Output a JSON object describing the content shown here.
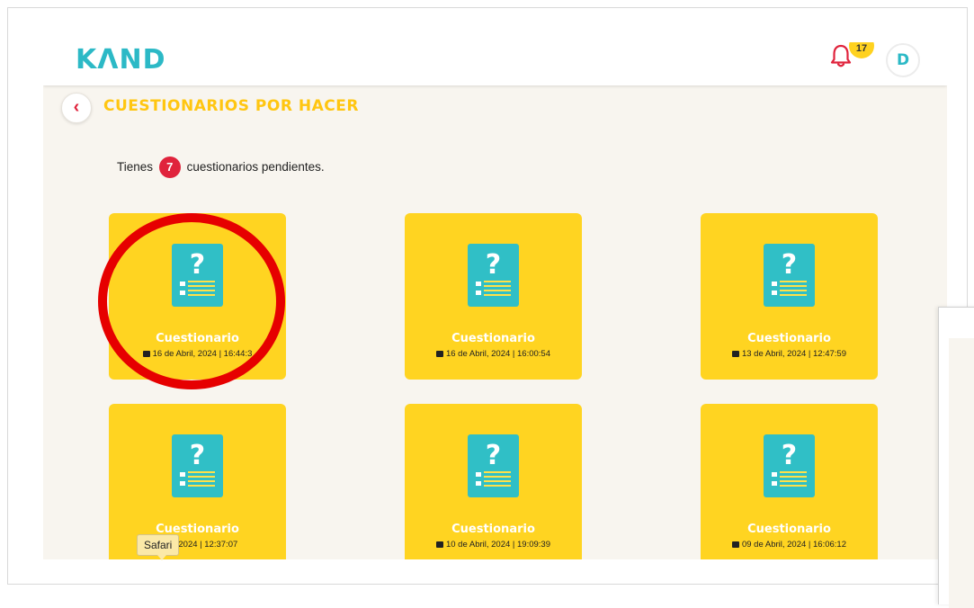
{
  "brand": {
    "logo": "KɅND"
  },
  "header": {
    "notification_count": "17",
    "avatar_initial": "D"
  },
  "page": {
    "back_icon": "‹",
    "title": "CUESTIONARIOS POR HACER"
  },
  "summary": {
    "prefix": "Tienes",
    "count": "7",
    "suffix": "cuestionarios pendientes."
  },
  "cards": [
    {
      "title": "Cuestionario",
      "date": "16 de Abril, 2024 | 16:44:3"
    },
    {
      "title": "Cuestionario",
      "date": "16 de Abril, 2024 | 16:00:54"
    },
    {
      "title": "Cuestionario",
      "date": "13 de Abril, 2024 | 12:47:59"
    },
    {
      "title": "Cuestionario",
      "date": "ril, 2024 | 12:37:07"
    },
    {
      "title": "Cuestionario",
      "date": "10 de Abril, 2024 | 19:09:39"
    },
    {
      "title": "Cuestionario",
      "date": "09 de Abril, 2024 | 16:06:12"
    }
  ],
  "tooltip": {
    "text": "Safari"
  },
  "colors": {
    "brand_teal": "#2cb9c6",
    "accent_yellow": "#ffd421",
    "title_yellow": "#ffc611",
    "alert_red": "#e0233c",
    "background": "#f8f5ef"
  },
  "icons": {
    "back": "chevron-left-icon",
    "bell": "bell-icon",
    "questionnaire": "questionnaire-document-icon",
    "date": "calendar-icon"
  }
}
